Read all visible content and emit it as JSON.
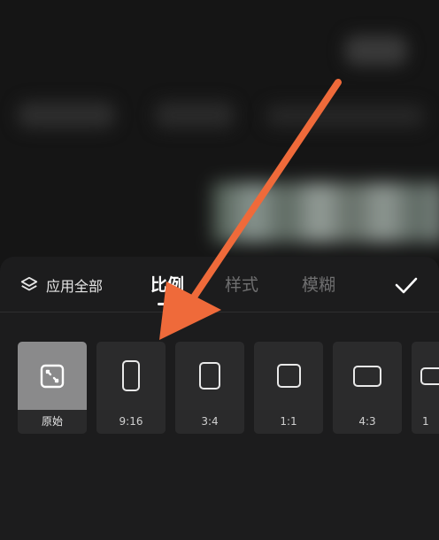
{
  "panel": {
    "apply_all_label": "应用全部",
    "tabs": [
      {
        "label": "比例",
        "active": true
      },
      {
        "label": "样式",
        "active": false
      },
      {
        "label": "模糊",
        "active": false
      }
    ]
  },
  "ratios": [
    {
      "label": "原始",
      "selected": true,
      "icon": "fit-original-icon"
    },
    {
      "label": "9:16",
      "selected": false,
      "icon": "ratio-9-16-icon"
    },
    {
      "label": "3:4",
      "selected": false,
      "icon": "ratio-3-4-icon"
    },
    {
      "label": "1:1",
      "selected": false,
      "icon": "ratio-1-1-icon"
    },
    {
      "label": "4:3",
      "selected": false,
      "icon": "ratio-4-3-icon"
    },
    {
      "label": "1",
      "selected": false,
      "icon": "ratio-partial-icon"
    }
  ],
  "colors": {
    "annotation_arrow": "#ef6a3a",
    "panel_bg": "#1c1c1d",
    "selected_tile": "#8a8a8b"
  }
}
